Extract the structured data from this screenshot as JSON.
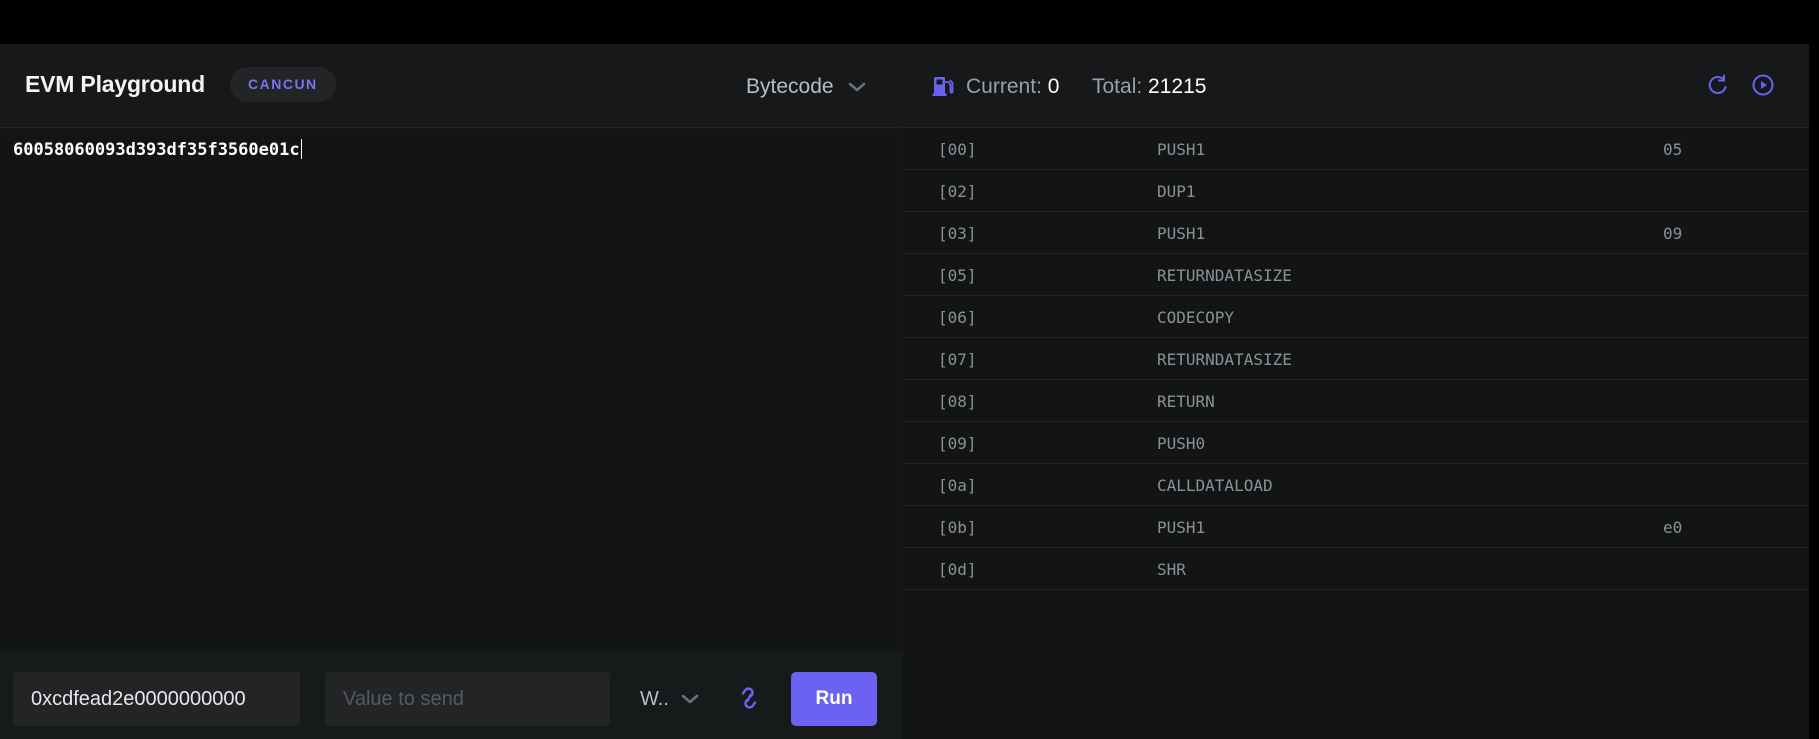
{
  "app": {
    "title": "EVM Playground",
    "fork_badge": "CANCUN"
  },
  "editor": {
    "mode": "Bytecode",
    "code": "60058060093d393df35f3560e01c"
  },
  "controls": {
    "calldata_value": "0xcdfead2e0000000000",
    "value_placeholder": "Value to send",
    "unit": "W..",
    "run_label": "Run"
  },
  "gas": {
    "current_label": "Current:",
    "current_value": "0",
    "total_label": "Total:",
    "total_value": "21215"
  },
  "opcodes": [
    {
      "offset": "[00]",
      "name": "PUSH1",
      "arg": "05"
    },
    {
      "offset": "[02]",
      "name": "DUP1",
      "arg": ""
    },
    {
      "offset": "[03]",
      "name": "PUSH1",
      "arg": "09"
    },
    {
      "offset": "[05]",
      "name": "RETURNDATASIZE",
      "arg": ""
    },
    {
      "offset": "[06]",
      "name": "CODECOPY",
      "arg": ""
    },
    {
      "offset": "[07]",
      "name": "RETURNDATASIZE",
      "arg": ""
    },
    {
      "offset": "[08]",
      "name": "RETURN",
      "arg": ""
    },
    {
      "offset": "[09]",
      "name": "PUSH0",
      "arg": ""
    },
    {
      "offset": "[0a]",
      "name": "CALLDATALOAD",
      "arg": ""
    },
    {
      "offset": "[0b]",
      "name": "PUSH1",
      "arg": "e0"
    },
    {
      "offset": "[0d]",
      "name": "SHR",
      "arg": ""
    }
  ],
  "icons": {
    "gas": "gas-pump-icon",
    "reset": "reset-icon",
    "play": "play-icon",
    "link": "link-icon",
    "chevron": "chevron-down-icon"
  },
  "colors": {
    "accent": "#6c62f2",
    "badge_text": "#7c72f5",
    "background": "#141617",
    "opcode_text": "#8b919a"
  }
}
